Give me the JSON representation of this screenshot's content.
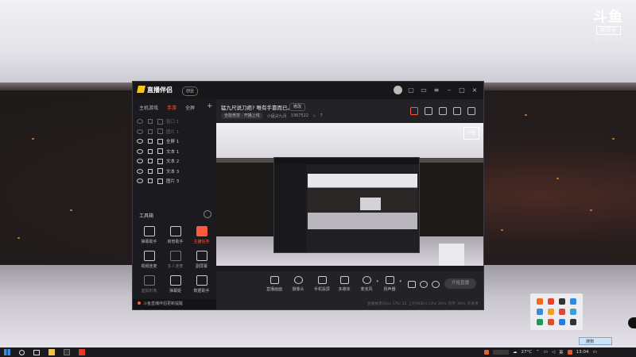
{
  "desktop_logo": {
    "name": "斗鱼",
    "room_tag": "房间号",
    "room_number": "3367522"
  },
  "app": {
    "name": "直播伴侣",
    "version_pill": "创业",
    "left_panel": {
      "tabs": [
        "主机游戏",
        "手游",
        "全屏"
      ],
      "add": "+",
      "scenes": [
        {
          "label": "窗口 1",
          "dim": true
        },
        {
          "label": "图片 1",
          "dim": true
        },
        {
          "label": "全屏 1",
          "dim": false
        },
        {
          "label": "文本 1",
          "dim": false
        },
        {
          "label": "文本 2",
          "dim": false
        },
        {
          "label": "文本 3",
          "dim": false
        },
        {
          "label": "图片 3",
          "dim": false
        }
      ],
      "toolbox_title": "工具箱",
      "tools": [
        {
          "label": "弹幕助手",
          "state": "normal"
        },
        {
          "label": "房管助手",
          "state": "normal"
        },
        {
          "label": "主播任务",
          "state": "hot"
        },
        {
          "label": "视频连麦",
          "state": "normal"
        },
        {
          "label": "多人连麦",
          "state": "faded"
        },
        {
          "label": "副屏幕",
          "state": "normal"
        },
        {
          "label": "虚拟形象",
          "state": "faded"
        },
        {
          "label": "弹幕姬",
          "state": "normal"
        },
        {
          "label": "数据助手",
          "state": "normal"
        }
      ],
      "notice": "斗鱼直播伴侣更新提醒"
    },
    "main": {
      "room_title": "猛九尺说刀疤? 唯有手靠而已。",
      "edit_label": "修改",
      "category": "全能竞技 · 开播上线",
      "streamer": "小猛尖九月",
      "room_id": "3367522",
      "heat": "7",
      "preview_logo": "斗鱼",
      "controls": [
        "直播画面",
        "摄像头",
        "手机投屏",
        "多媒体",
        "麦克风",
        "扬声器"
      ],
      "start_button": "开始直播",
      "status_text": "直播帧率0fps  CPU 32  上行0KB/s  CPU 20%  内存 38%  开发者"
    }
  },
  "tray": {
    "tooltip": "搜狗",
    "colors": [
      "#f26b1d",
      "#e6432a",
      "#333333",
      "#2b8be6",
      "#3c8cd8",
      "#f0a020",
      "#d94a3a",
      "#3aa0e0",
      "#1c9a5a",
      "#e04b2c",
      "#2a7ee0",
      "#333333"
    ]
  },
  "taskbar": {
    "temperature": "27°C",
    "ime": "英",
    "time": "13:04"
  }
}
